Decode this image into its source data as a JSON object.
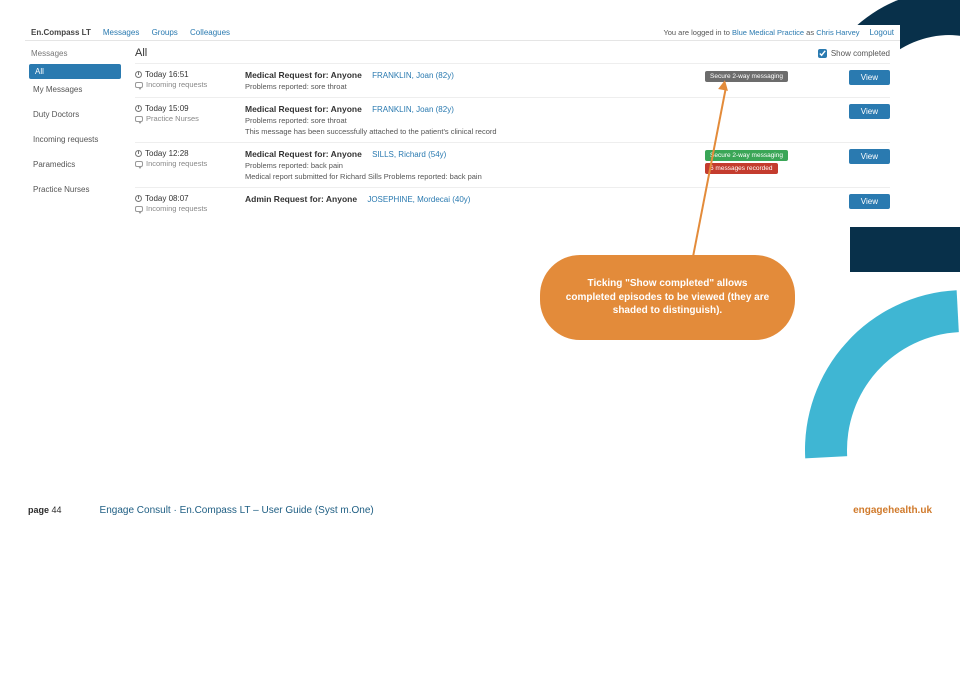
{
  "topbar": {
    "brand": "En.Compass LT",
    "nav": {
      "messages": "Messages",
      "groups": "Groups",
      "colleagues": "Colleagues"
    },
    "login_prefix": "You are logged in to ",
    "practice": "Blue Medical Practice",
    "as": " as ",
    "user": "Chris Harvey",
    "logout": "Logout"
  },
  "sidebar": {
    "title": "Messages",
    "all": "All",
    "my": "My Messages",
    "duty": "Duty Doctors",
    "incoming": "Incoming requests",
    "paramedics": "Paramedics",
    "nurses": "Practice Nurses"
  },
  "content": {
    "heading": "All",
    "show_completed": "Show completed",
    "view": "View"
  },
  "rows": [
    {
      "time": "Today 16:51",
      "tag": "Incoming requests",
      "title": "Medical Request for: Anyone",
      "patient": "FRANKLIN, Joan (82y)",
      "sub": "Problems reported: sore throat",
      "badges": [
        {
          "cls": "gray",
          "label": "Secure 2-way messaging"
        }
      ]
    },
    {
      "time": "Today 15:09",
      "tag": "Practice Nurses",
      "title": "Medical Request for: Anyone",
      "patient": "FRANKLIN, Joan (82y)",
      "sub": "Problems reported: sore throat\nThis message has been successfully attached to the patient's clinical record",
      "badges": []
    },
    {
      "time": "Today 12:28",
      "tag": "Incoming requests",
      "title": "Medical Request for: Anyone",
      "patient": "SILLS, Richard (54y)",
      "sub": "Problems reported: back pain\nMedical report submitted for Richard Sills Problems reported: back pain",
      "badges": [
        {
          "cls": "green",
          "label": "Secure 2-way messaging"
        },
        {
          "cls": "red",
          "label": "6 messages recorded"
        }
      ]
    },
    {
      "time": "Today 08:07",
      "tag": "Incoming requests",
      "title": "Admin Request for: Anyone",
      "patient": "JOSEPHINE, Mordecai (40y)",
      "sub": "",
      "badges": []
    }
  ],
  "callout": "Ticking \"Show completed\" allows completed episodes to be viewed (they are shaded to distinguish).",
  "footer": {
    "page_label": "page ",
    "page_num": "44",
    "doc_title": "Engage Consult · En.Compass LT – User Guide (Syst m.One)",
    "site": "engagehealth.uk"
  }
}
